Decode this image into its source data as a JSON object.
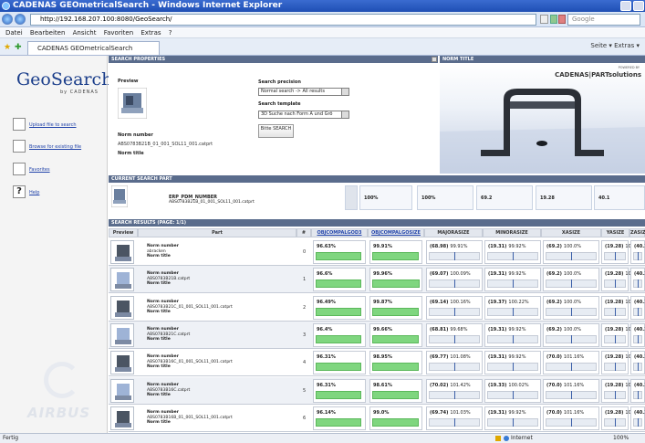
{
  "window": {
    "title": "CADENAS GEOmetricalSearch - Windows Internet Explorer"
  },
  "browser": {
    "url": "http://192.168.207.100:8080/GeoSearch/",
    "search_placeholder": "Google",
    "menu": [
      "Datei",
      "Bearbeiten",
      "Ansicht",
      "Favoriten",
      "Extras",
      "?"
    ],
    "tab_title": "CADENAS GEOmetricalSearch",
    "commands": "Seite ▾  Extras ▾",
    "status_left": "Fertig",
    "status_zone": "Internet",
    "zoom": "100%"
  },
  "sidebar": {
    "logo": "GeoSearch",
    "logo_by": "by CADENAS",
    "links": [
      {
        "label": "Upload file to search",
        "icon": "upload-icon"
      },
      {
        "label": "Browse for existing file",
        "icon": "browse-icon"
      },
      {
        "label": "Favorites",
        "icon": "favorites-icon"
      },
      {
        "label": "Help",
        "icon": "help-icon"
      }
    ],
    "brand": "AIRBUS"
  },
  "search_properties": {
    "header": "SEARCH PROPERTIES",
    "preview_label": "Preview",
    "norm_number_label": "Norm number",
    "norm_number_value": "ABS0783B21B_01_001_SOL11_001.catprt",
    "norm_title_label": "Norm title",
    "precision_label": "Search precision",
    "precision_value": "Normal search -> All results",
    "template_label": "Search template",
    "template_value": "3D Suche nach Form A und Grö",
    "search_button": "Bitte SEARCH"
  },
  "norm_title_panel": {
    "header": "NORM TITLE",
    "powered_by": "POWERED BY",
    "brand": "CADENAS|PARTsolutions"
  },
  "current_search": {
    "header": "CURRENT SEARCH PART",
    "part_title": "ERP_PDM_NUMBER",
    "part_number": "ABS0783B21B_01_001_SOL11_001.catprt",
    "values": [
      "100%",
      "100%",
      "69.2",
      "19.28",
      "40.1"
    ]
  },
  "results": {
    "header": "SEARCH RESULTS (PAGE: 1/1)",
    "columns": [
      "Preview",
      "Part",
      "#",
      "OBJCOMPALGOD3",
      "OBJCOMPALGOSIZE",
      "MAJORASIZE",
      "MINORASIZE",
      "XASIZE",
      "YASIZE",
      "ZASIZE"
    ],
    "rows": [
      {
        "part": [
          "Norm number",
          "abracken",
          "Norm title"
        ],
        "idx": "0",
        "d3": "96.63%",
        "d3_fill": 0.97,
        "size": "99.91%",
        "size_fill": 0.99,
        "major": "(68.98)",
        "major_p": "99.91%",
        "minor": "(19.31)",
        "minor_p": "99.92%",
        "xa": "(69.2)",
        "xa_p": "100.0%",
        "ya": "(19.28)",
        "ya_p": "100.0%",
        "za": "(40.1)",
        "za_p": "100.0%"
      },
      {
        "part": [
          "Norm number",
          "ABS0783B21B.catprt",
          "Norm title"
        ],
        "idx": "1",
        "d3": "96.6%",
        "d3_fill": 0.97,
        "size": "99.96%",
        "size_fill": 1.0,
        "major": "(69.07)",
        "major_p": "100.09%",
        "minor": "(19.31)",
        "minor_p": "99.92%",
        "xa": "(69.2)",
        "xa_p": "100.0%",
        "ya": "(19.28)",
        "ya_p": "100.0%",
        "za": "(40.1)",
        "za_p": "100.0%"
      },
      {
        "part": [
          "Norm number",
          "ABS0783B21C_01_001_SOL11_001.catprt",
          "Norm title"
        ],
        "idx": "2",
        "d3": "96.49%",
        "d3_fill": 0.96,
        "size": "99.87%",
        "size_fill": 0.99,
        "major": "(69.14)",
        "major_p": "100.16%",
        "minor": "(19.37)",
        "minor_p": "100.22%",
        "xa": "(69.2)",
        "xa_p": "100.0%",
        "ya": "(19.28)",
        "ya_p": "100.0%",
        "za": "(40.1)",
        "za_p": "100.0%"
      },
      {
        "part": [
          "Norm number",
          "ABS0783B21C.catprt",
          "Norm title"
        ],
        "idx": "3",
        "d3": "96.4%",
        "d3_fill": 0.96,
        "size": "99.66%",
        "size_fill": 0.99,
        "major": "(68.81)",
        "major_p": "99.68%",
        "minor": "(19.31)",
        "minor_p": "99.92%",
        "xa": "(69.2)",
        "xa_p": "100.0%",
        "ya": "(19.28)",
        "ya_p": "100.0%",
        "za": "(40.1)",
        "za_p": "100.0%"
      },
      {
        "part": [
          "Norm number",
          "ABS0783B16C_01_001_SOL11_001.catprt",
          "Norm title"
        ],
        "idx": "4",
        "d3": "96.31%",
        "d3_fill": 0.96,
        "size": "98.95%",
        "size_fill": 0.98,
        "major": "(69.77)",
        "major_p": "101.08%",
        "minor": "(19.31)",
        "minor_p": "99.92%",
        "xa": "(70.0)",
        "xa_p": "101.16%",
        "ya": "(19.28)",
        "ya_p": "100.0%",
        "za": "(40.1)",
        "za_p": "100.0%"
      },
      {
        "part": [
          "Norm number",
          "ABS0783B16C.catprt",
          "Norm title"
        ],
        "idx": "5",
        "d3": "96.31%",
        "d3_fill": 0.96,
        "size": "98.61%",
        "size_fill": 0.98,
        "major": "(70.02)",
        "major_p": "101.42%",
        "minor": "(19.33)",
        "minor_p": "100.02%",
        "xa": "(70.0)",
        "xa_p": "101.16%",
        "ya": "(19.28)",
        "ya_p": "100.0%",
        "za": "(40.1)",
        "za_p": "100.0%"
      },
      {
        "part": [
          "Norm number",
          "ABS0783B16B_01_001_SOL11_001.catprt",
          "Norm title"
        ],
        "idx": "6",
        "d3": "96.14%",
        "d3_fill": 0.96,
        "size": "99.0%",
        "size_fill": 0.98,
        "major": "(69.74)",
        "major_p": "101.03%",
        "minor": "(19.31)",
        "minor_p": "99.92%",
        "xa": "(70.0)",
        "xa_p": "101.16%",
        "ya": "(19.28)",
        "ya_p": "100.0%",
        "za": "(40.1)",
        "za_p": "100.0%"
      }
    ]
  }
}
